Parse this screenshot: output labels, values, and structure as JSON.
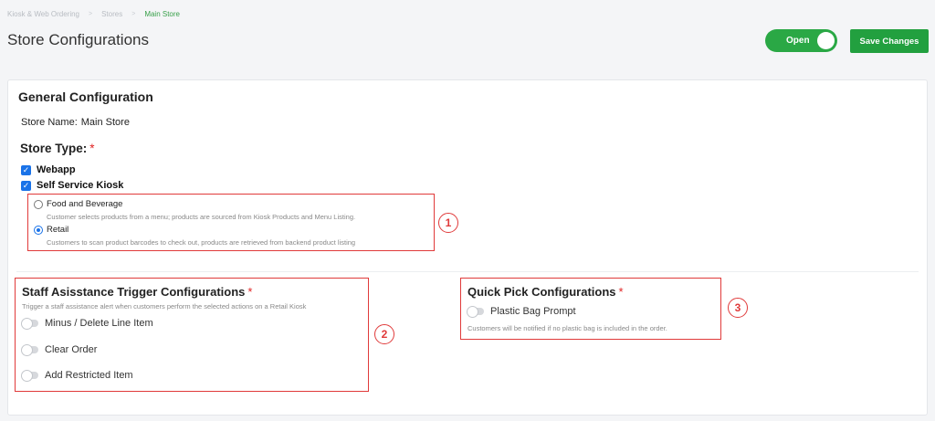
{
  "breadcrumb": [
    "Kiosk & Web Ordering",
    "Stores",
    "Main Store"
  ],
  "page_title": "Store Configurations",
  "header": {
    "open_label": "Open",
    "open_state": true,
    "save_label": "Save Changes"
  },
  "general": {
    "title": "General Configuration",
    "store_name_label": "Store Name:",
    "store_name_value": "Main Store",
    "store_type_label": "Store Type:",
    "required_mark": "*",
    "types": [
      {
        "label": "Webapp",
        "checked": true
      },
      {
        "label": "Self Service Kiosk",
        "checked": true
      }
    ],
    "kiosk_modes": [
      {
        "label": "Food and Beverage",
        "selected": false,
        "description": "Customer selects products from a menu; products are sourced from Kiosk Products and Menu Listing."
      },
      {
        "label": "Retail",
        "selected": true,
        "description": "Customers to scan product barcodes to check out, products are retrieved from backend product listing"
      }
    ]
  },
  "staff_assistance": {
    "title": "Staff Asisstance Trigger Configurations",
    "required_mark": "*",
    "subtitle": "Trigger a staff assistance alert when customers perform the selected actions on a Retail Kiosk",
    "options": [
      {
        "label": "Minus / Delete Line Item",
        "enabled": false
      },
      {
        "label": "Clear Order",
        "enabled": false
      },
      {
        "label": "Add Restricted Item",
        "enabled": false
      }
    ]
  },
  "quick_pick": {
    "title": "Quick Pick Configurations",
    "required_mark": "*",
    "option_label": "Plastic Bag Prompt",
    "option_enabled": false,
    "description": "Customers will be notified if no plastic bag is included in the order."
  },
  "annotations": [
    "1",
    "2",
    "3"
  ],
  "colors": {
    "accent_green": "#22a03f",
    "annotation_red": "#e03a3a",
    "check_blue": "#1a73e8"
  }
}
